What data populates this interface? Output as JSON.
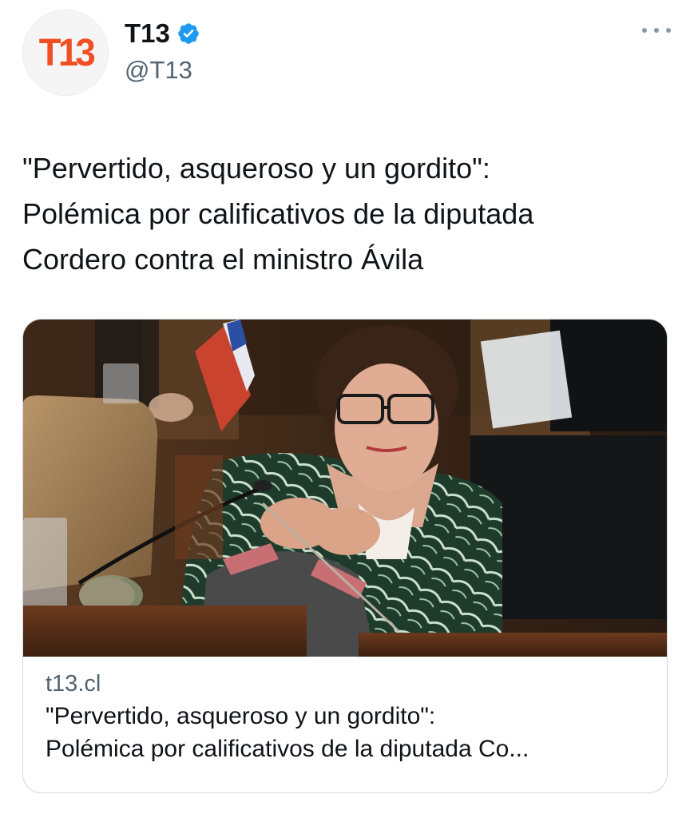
{
  "account": {
    "display_name": "T13",
    "handle": "@T13",
    "avatar_logo_text": "T13",
    "verified": true,
    "brand_color": "#f04e23",
    "verified_color": "#1d9bf0"
  },
  "menu": {
    "icon": "more-horizontal-icon"
  },
  "tweet": {
    "text": "\"Pervertido, asqueroso y un gordito\":\nPolémica por calificativos de la diputada\nCordero contra el ministro Ávila"
  },
  "card": {
    "domain": "t13.cl",
    "title_line1": "\"Pervertido, asqueroso y un gordito\":",
    "title_line2": "Polémica por calificativos de la diputada Co..."
  }
}
